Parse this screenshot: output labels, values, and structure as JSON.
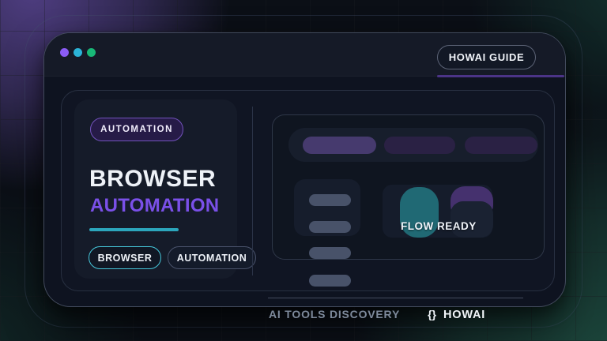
{
  "window": {
    "traffic_lights": [
      {
        "name": "purple-dot",
        "color": "#8b5cf6"
      },
      {
        "name": "cyan-dot",
        "color": "#2bb4d8"
      },
      {
        "name": "green-dot",
        "color": "#18b877"
      }
    ],
    "guide_button_label": "HOWAI GUIDE"
  },
  "hero": {
    "badge_label": "AUTOMATION",
    "title_line1": "BROWSER",
    "title_line2": "AUTOMATION",
    "buttons": [
      {
        "label": "BROWSER",
        "style": "teal-outline"
      },
      {
        "label": "AUTOMATION",
        "style": "slate-outline"
      }
    ]
  },
  "preview": {
    "status_label": "FLOW READY"
  },
  "footer": {
    "tagline": "AI TOOLS DISCOVERY",
    "brace_icon": "{}",
    "brand": "HOWAI"
  },
  "colors": {
    "accent-violet": "#7a50e8",
    "accent-teal": "#2ca6bc",
    "badge-border": "#7353bd",
    "underline-purple": "#4b3487",
    "dot-purple": "#8b5cf6",
    "dot-cyan": "#2bb4d8",
    "dot-green": "#18b877",
    "pill-purple-bright": "#463a6e",
    "pill-purple-dark": "#2a2144",
    "shape-teal": "#206974",
    "shape-purple": "#45316e",
    "skeleton-gray": "#485269"
  }
}
